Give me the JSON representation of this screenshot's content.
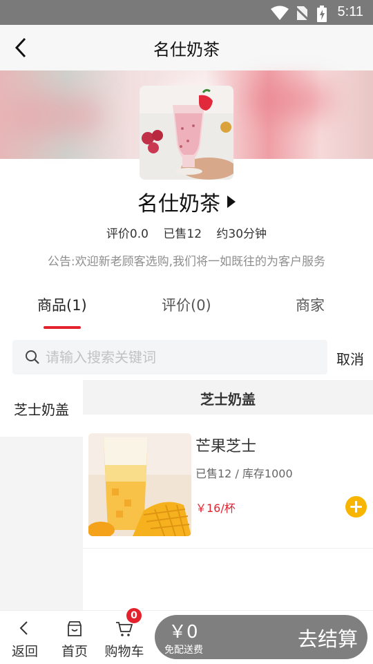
{
  "status_bar": {
    "time": "5:11"
  },
  "nav": {
    "title": "名仕奶茶"
  },
  "shop": {
    "name": "名仕奶茶",
    "rating": "评价0.0",
    "sold": "已售12",
    "delivery_time": "约30分钟",
    "notice_label": "公告:",
    "notice_text": "欢迎新老顾客选购,我们将一如既往的为客户服务"
  },
  "tabs": [
    {
      "label": "商品(1)",
      "active": true
    },
    {
      "label": "评价(0)",
      "active": false
    },
    {
      "label": "商家",
      "active": false
    }
  ],
  "search": {
    "placeholder": "请输入搜索关键词",
    "value": "",
    "cancel_label": "取消"
  },
  "categories": [
    {
      "label": "芝士奶盖",
      "active": true
    }
  ],
  "section": {
    "title": "芝士奶盖"
  },
  "products": [
    {
      "name": "芒果芝士",
      "sales": "已售12 / 库存1000",
      "price": "￥16/杯"
    }
  ],
  "bottom_bar": {
    "back_label": "返回",
    "home_label": "首页",
    "cart_label": "购物车",
    "cart_count": "0",
    "total": "￥0",
    "delivery_note": "免配送费",
    "checkout_label": "去结算"
  },
  "colors": {
    "accent_red": "#e4222e",
    "add_button": "#f8b500",
    "checkout_bg": "#7f7f7f",
    "status_bar_bg": "#7a7a7a"
  },
  "icons": [
    "wifi-icon",
    "no-sim-icon",
    "battery-icon",
    "back-arrow-icon",
    "play-triangle-icon",
    "search-icon",
    "plus-icon",
    "store-icon",
    "cart-icon"
  ]
}
